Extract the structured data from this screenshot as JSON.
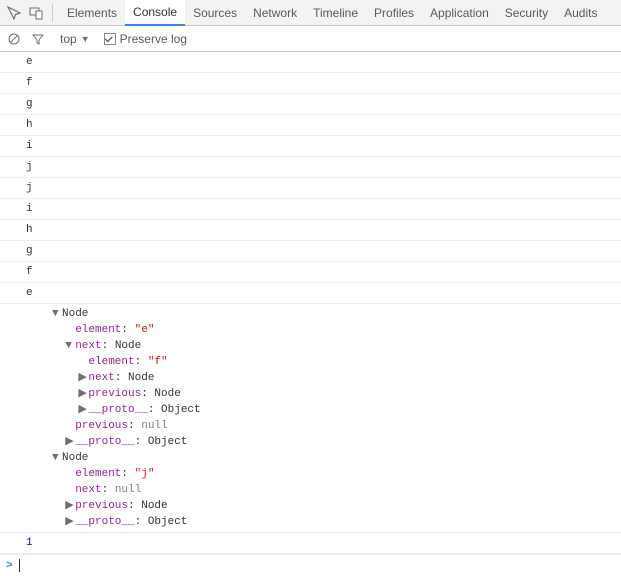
{
  "tabs": [
    "Elements",
    "Console",
    "Sources",
    "Network",
    "Timeline",
    "Profiles",
    "Application",
    "Security",
    "Audits"
  ],
  "activeTab": "Console",
  "subbar": {
    "context": "top",
    "preserveLabel": "Preserve log",
    "preserveChecked": true
  },
  "logs": [
    "e",
    "f",
    "g",
    "h",
    "i",
    "j",
    "j",
    "i",
    "h",
    "g",
    "f",
    "e"
  ],
  "tree": [
    {
      "indent": 0,
      "caret": "▼",
      "cls": "k-class",
      "text": "Node"
    },
    {
      "indent": 1,
      "caret": " ",
      "prop": "element",
      "sep": ": ",
      "val": "\"e\"",
      "valcls": "k-str"
    },
    {
      "indent": 1,
      "caret": "▼",
      "prop": "next",
      "sep": ": ",
      "val": "Node",
      "valcls": "k-class"
    },
    {
      "indent": 2,
      "caret": " ",
      "prop": "element",
      "sep": ": ",
      "val": "\"f\"",
      "valcls": "k-str"
    },
    {
      "indent": 2,
      "caret": "▶",
      "prop": "next",
      "sep": ": ",
      "val": "Node",
      "valcls": "k-class"
    },
    {
      "indent": 2,
      "caret": "▶",
      "prop": "previous",
      "sep": ": ",
      "val": "Node",
      "valcls": "k-class"
    },
    {
      "indent": 2,
      "caret": "▶",
      "prop": "__proto__",
      "sep": ": ",
      "val": "Object",
      "valcls": "k-class"
    },
    {
      "indent": 1,
      "caret": " ",
      "prop": "previous",
      "sep": ": ",
      "val": "null",
      "valcls": "k-kw"
    },
    {
      "indent": 1,
      "caret": "▶",
      "prop": "__proto__",
      "sep": ": ",
      "val": "Object",
      "valcls": "k-class"
    },
    {
      "indent": 0,
      "caret": "▼",
      "cls": "k-class",
      "text": "Node"
    },
    {
      "indent": 1,
      "caret": " ",
      "prop": "element",
      "sep": ": ",
      "val": "\"j\"",
      "valcls": "k-str"
    },
    {
      "indent": 1,
      "caret": " ",
      "prop": "next",
      "sep": ": ",
      "val": "null",
      "valcls": "k-kw"
    },
    {
      "indent": 1,
      "caret": "▶",
      "prop": "previous",
      "sep": ": ",
      "val": "Node",
      "valcls": "k-class"
    },
    {
      "indent": 1,
      "caret": "▶",
      "prop": "__proto__",
      "sep": ": ",
      "val": "Object",
      "valcls": "k-class"
    }
  ],
  "finalLogNumber": "1",
  "prompt": ">"
}
